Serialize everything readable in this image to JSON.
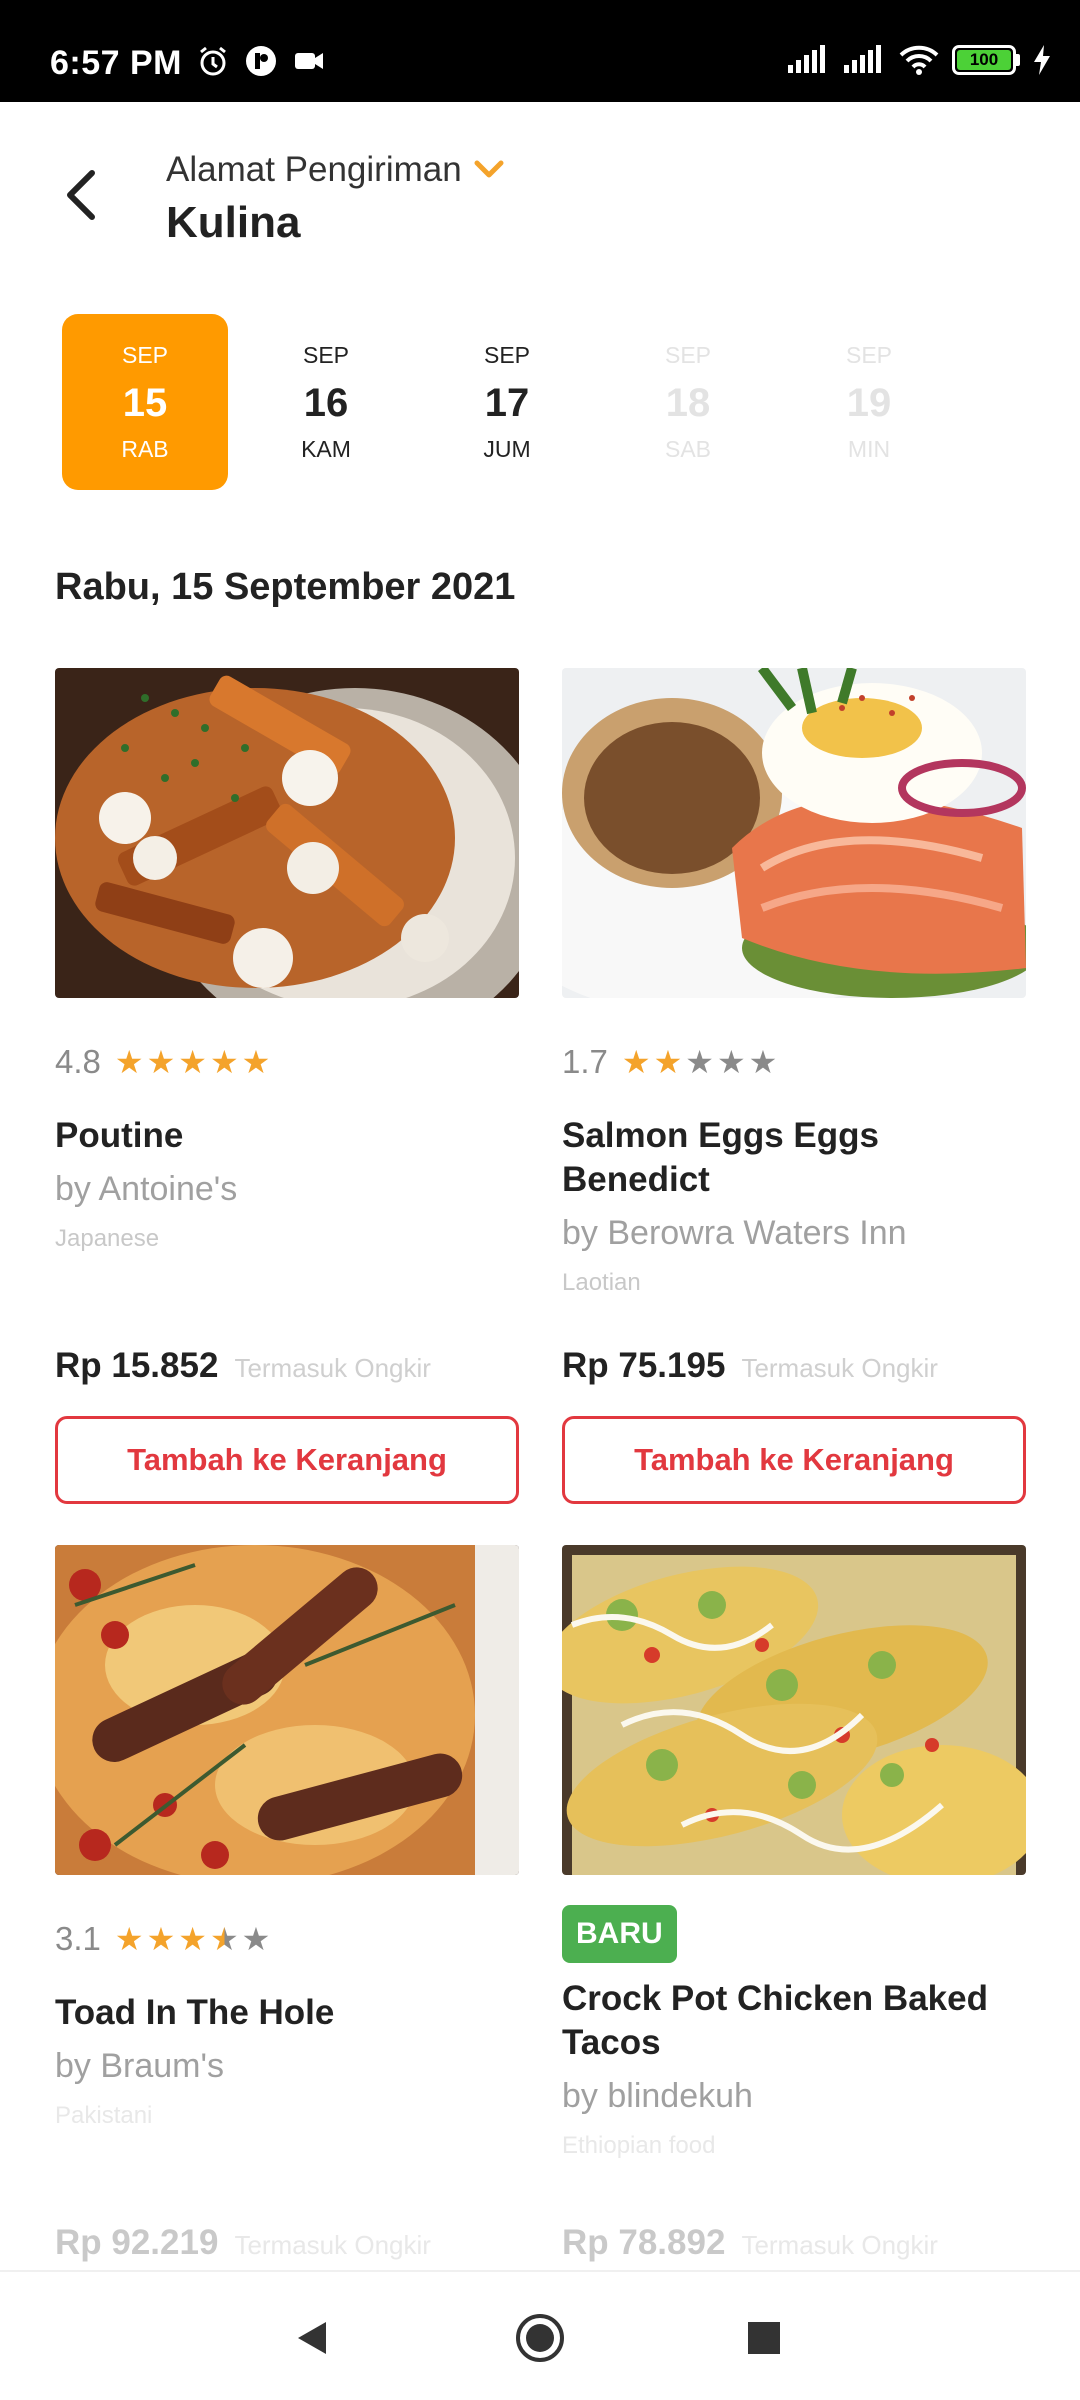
{
  "status_bar": {
    "time": "6:57 PM",
    "battery": "100"
  },
  "header": {
    "address_label": "Alamat Pengiriman",
    "address_name": "Kulina"
  },
  "dates": [
    {
      "month": "SEP",
      "day": "15",
      "weekday": "RAB",
      "state": "selected"
    },
    {
      "month": "SEP",
      "day": "16",
      "weekday": "KAM",
      "state": "available"
    },
    {
      "month": "SEP",
      "day": "17",
      "weekday": "JUM",
      "state": "available"
    },
    {
      "month": "SEP",
      "day": "18",
      "weekday": "SAB",
      "state": "disabled"
    },
    {
      "month": "SEP",
      "day": "19",
      "weekday": "MIN",
      "state": "disabled"
    }
  ],
  "section_date": "Rabu, 15 September 2021",
  "products": [
    {
      "rating": "4.8",
      "stars": 4.8,
      "name": "Poutine",
      "merchant": "by Antoine's",
      "cuisine": "Japanese",
      "price": "Rp 15.852",
      "price_note": "Termasuk Ongkir",
      "button": "Tambah ke Keranjang"
    },
    {
      "rating": "1.7",
      "stars": 1.7,
      "name": "Salmon Eggs Eggs Benedict",
      "merchant": "by Berowra Waters Inn",
      "cuisine": "Laotian",
      "price": "Rp 75.195",
      "price_note": "Termasuk Ongkir",
      "button": "Tambah ke Keranjang"
    },
    {
      "rating": "3.1",
      "stars": 3.1,
      "name": "Toad In The Hole",
      "merchant": "by Braum's",
      "cuisine": "Pakistani",
      "price": "Rp 92.219",
      "price_note": "Termasuk Ongkir"
    },
    {
      "badge": "BARU",
      "name_line1": "Crock Pot Chicken Baked",
      "name_line2": "Tacos",
      "merchant": "by blindekuh",
      "cuisine": "Ethiopian food",
      "price": "Rp 78.892",
      "price_note": "Termasuk Ongkir"
    }
  ],
  "colors": {
    "accent": "#ff9a00",
    "button_red": "#e2383f",
    "star": "#f4a32b",
    "badge_green": "#4caf50"
  },
  "icons": [
    "alarm-icon",
    "app-icon",
    "video-icon",
    "signal-icon",
    "wifi-icon",
    "battery-icon",
    "charging-icon",
    "back-arrow-icon",
    "chevron-down-icon",
    "nav-back-icon",
    "nav-home-icon",
    "nav-recents-icon"
  ]
}
